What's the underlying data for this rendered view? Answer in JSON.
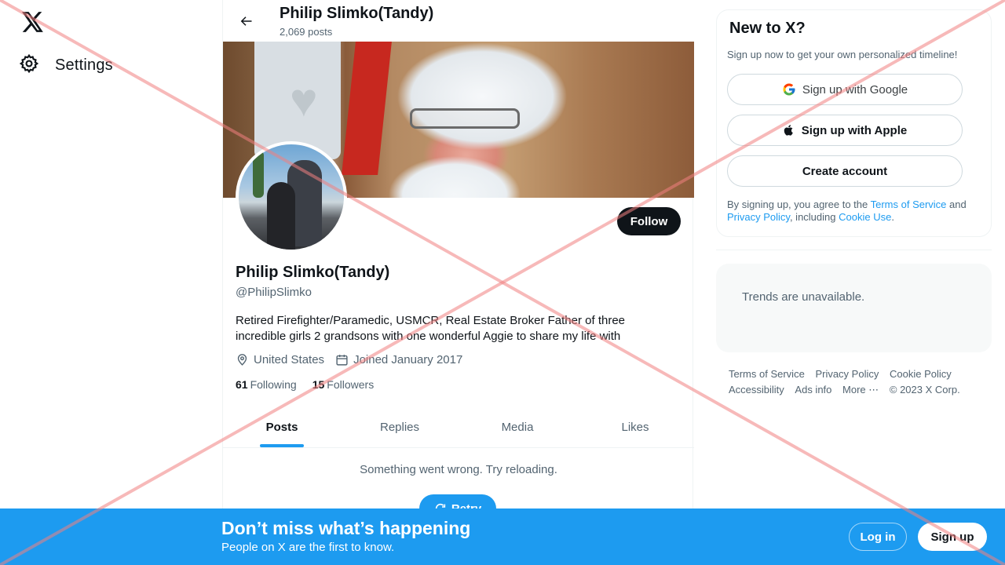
{
  "nav": {
    "logo_icon": "x-logo-icon",
    "settings_label": "Settings",
    "settings_icon": "gear-icon"
  },
  "header": {
    "title": "Philip Slimko(Tandy)",
    "post_count": "2,069 posts",
    "back_icon": "arrow-left-icon"
  },
  "profile": {
    "name": "Philip Slimko(Tandy)",
    "handle": "@PhilipSlimko",
    "bio": "Retired Firefighter/Paramedic, USMCR, Real Estate Broker Father of three incredible girls 2 grandsons with one wonderful Aggie to share my life with",
    "location": "United States",
    "joined": "Joined January 2017",
    "following_count": "61",
    "following_label": "Following",
    "followers_count": "15",
    "followers_label": "Followers",
    "follow_label": "Follow"
  },
  "tabs": [
    {
      "label": "Posts",
      "active": true
    },
    {
      "label": "Replies",
      "active": false
    },
    {
      "label": "Media",
      "active": false
    },
    {
      "label": "Likes",
      "active": false
    }
  ],
  "feed": {
    "error_text": "Something went wrong. Try reloading.",
    "retry_label": "Retry"
  },
  "signup_card": {
    "title": "New to X?",
    "subtitle": "Sign up now to get your own personalized timeline!",
    "google_label": "Sign up with Google",
    "apple_label": "Sign up with Apple",
    "create_label": "Create account",
    "terms_prefix": "By signing up, you agree to the ",
    "terms_link": "Terms of Service",
    "terms_and": " and ",
    "privacy_link": "Privacy Policy",
    "terms_including": ", including ",
    "cookie_link": "Cookie Use",
    "terms_end": "."
  },
  "trends": {
    "text": "Trends are unavailable."
  },
  "footer": {
    "links": [
      "Terms of Service",
      "Privacy Policy",
      "Cookie Policy",
      "Accessibility",
      "Ads info",
      "More ⋯",
      "© 2023 X Corp."
    ]
  },
  "bottom_bar": {
    "headline": "Don’t miss what’s happening",
    "subline": "People on X are the first to know.",
    "login_label": "Log in",
    "signup_label": "Sign up"
  },
  "colors": {
    "accent": "#1d9bf0",
    "overlay_x": "#f08080"
  }
}
